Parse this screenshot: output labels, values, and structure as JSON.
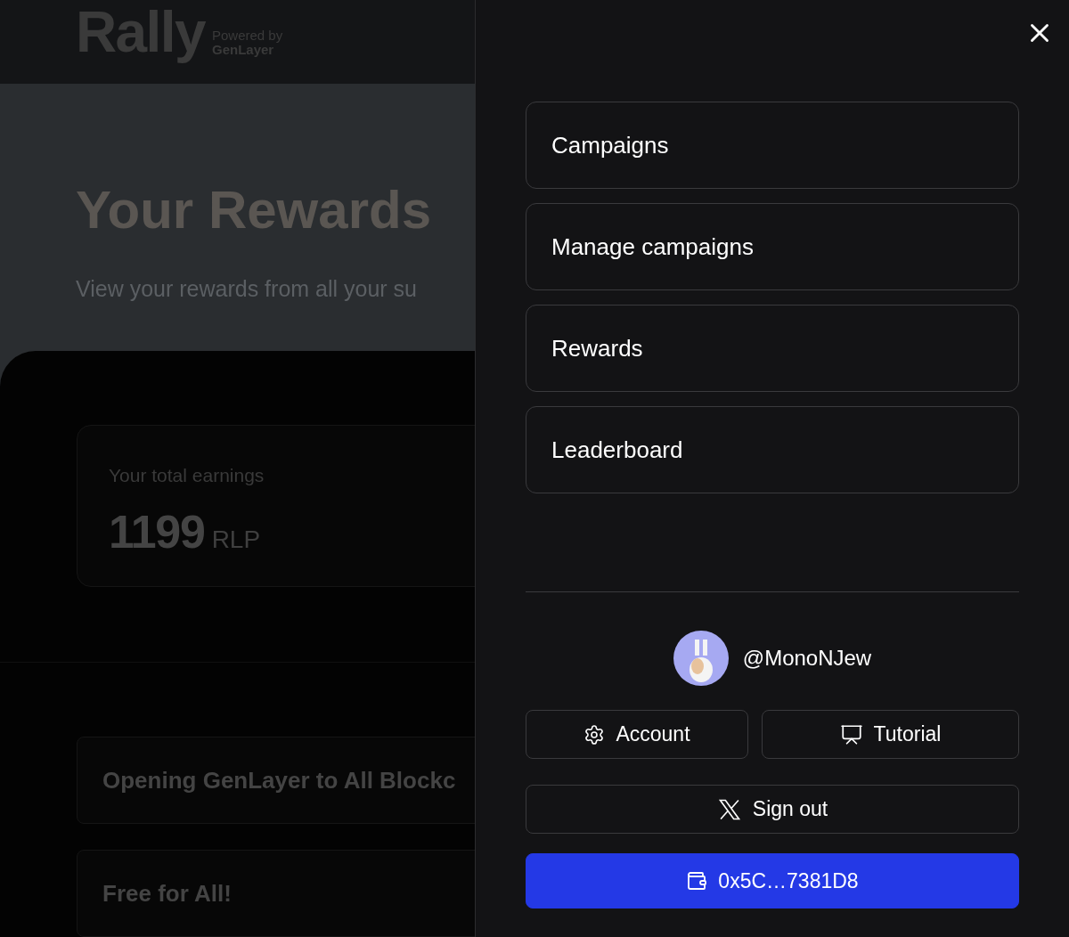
{
  "header": {
    "logo": "Rally",
    "powered_by": "Powered by",
    "partner": "GenLayer"
  },
  "page": {
    "title": "Your Rewards",
    "subtitle": "View your rewards from all your su",
    "earnings": {
      "label": "Your total earnings",
      "amount": "1199",
      "unit": "RLP"
    },
    "campaigns": [
      "Opening GenLayer to All Blockc",
      "Free for All!"
    ]
  },
  "menu": {
    "items": [
      "Campaigns",
      "Manage campaigns",
      "Rewards",
      "Leaderboard"
    ]
  },
  "user": {
    "handle": "@MonoNJew"
  },
  "actions": [
    {
      "kind": "account",
      "label": "Account"
    },
    {
      "kind": "tutorial",
      "label": "Tutorial"
    },
    {
      "kind": "signout",
      "label": "Sign out"
    },
    {
      "kind": "wallet",
      "label": "0x5C…7381D8"
    }
  ]
}
